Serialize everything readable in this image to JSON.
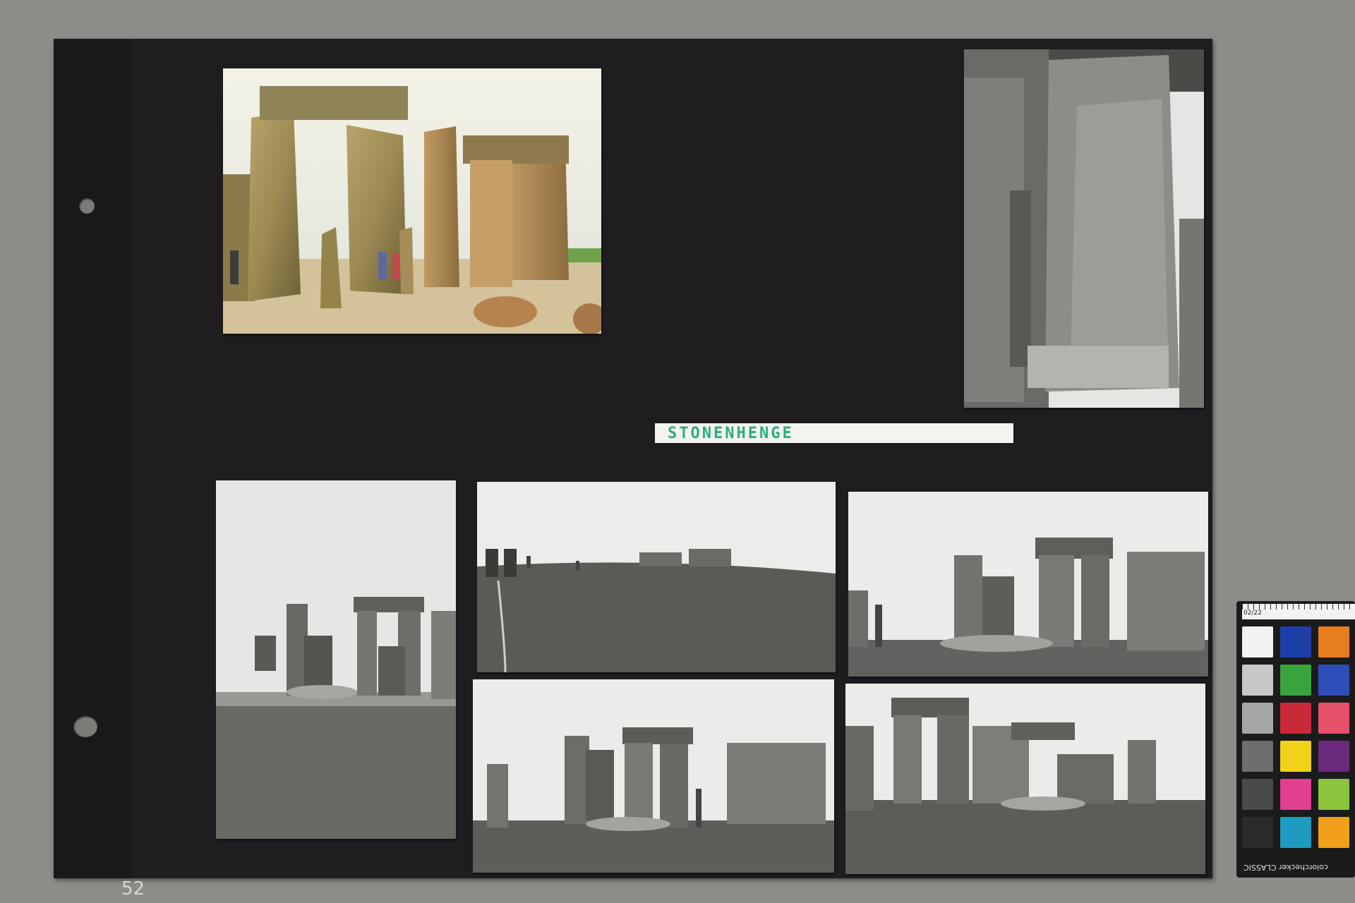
{
  "album": {
    "caption_label": "STONENHENGE",
    "page_number": "52"
  },
  "color_checker": {
    "brand_text": "colorchecker CLASSIC",
    "ruler_text": "02/22",
    "swatches": [
      "#f2f2f2",
      "#1f3fa8",
      "#e67e1f",
      "#c8c8c8",
      "#3aa43c",
      "#2f4eb8",
      "#a6a6a6",
      "#c92a3a",
      "#e5506a",
      "#6e6e6e",
      "#f0d21a",
      "#6a2a7c",
      "#4a4a4a",
      "#e0408e",
      "#8cc43c",
      "#2a2a2a",
      "#1e9bc0",
      "#f0a01a"
    ]
  }
}
